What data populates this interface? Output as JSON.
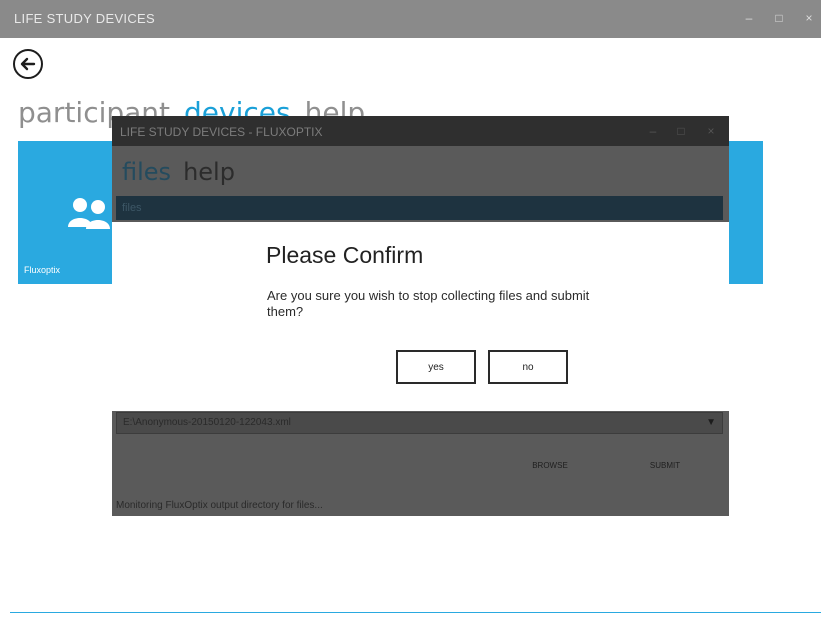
{
  "window": {
    "title": "LIFE STUDY DEVICES"
  },
  "nav": {
    "items": [
      "participant",
      "devices",
      "help"
    ],
    "active": "devices"
  },
  "tile": {
    "label": "Fluxoptix"
  },
  "inner": {
    "title": "LIFE STUDY DEVICES - FLUXOPTIX",
    "nav": [
      "files",
      "help"
    ],
    "bar_text": "files",
    "dropdown_value": "E:\\Anonymous-20150120-122043.xml",
    "buttons": {
      "browse": "BROWSE",
      "submit": "SUBMIT"
    },
    "status": "Monitoring FluxOptix output directory for files..."
  },
  "dialog": {
    "title": "Please Confirm",
    "message": "Are you sure you wish to stop collecting files and submit them?",
    "yes": "yes",
    "no": "no"
  },
  "colors": {
    "accent": "#2aa9e0",
    "titlebar": "#8a8a8a",
    "overlay": "#5a5a5a"
  }
}
